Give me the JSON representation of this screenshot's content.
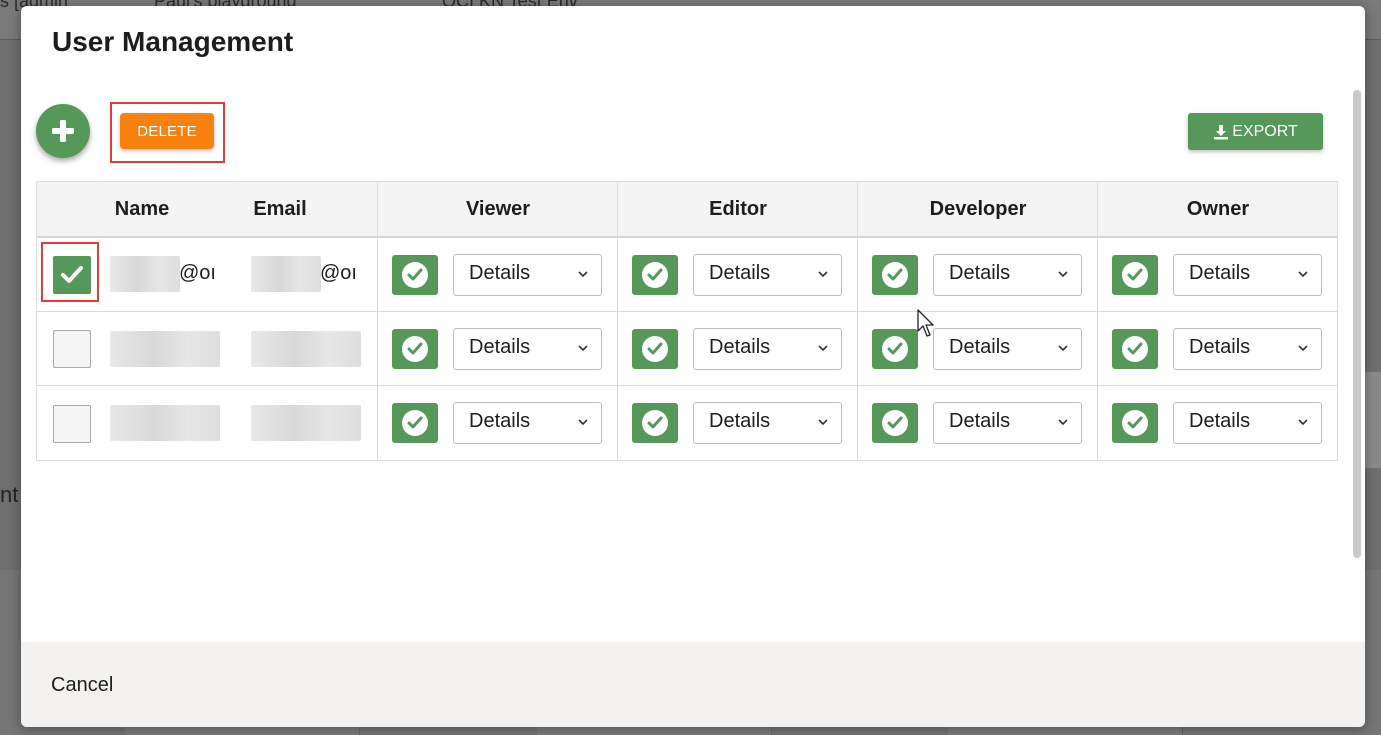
{
  "background": {
    "top_left_fragment": "s [admin",
    "top_title": "Paul's playground",
    "top_env": "OCI KN Test Env",
    "side_fragment": "nt"
  },
  "dialog": {
    "title": "User Management",
    "delete_label": "DELETE",
    "export_label": "EXPORT",
    "cancel_label": "Cancel",
    "accent_green": "#55985a",
    "accent_orange": "#f7820f"
  },
  "table": {
    "columns": [
      "Name",
      "Email",
      "Viewer",
      "Editor",
      "Developer",
      "Owner"
    ],
    "rows": [
      {
        "selected": true,
        "name_suffix": "@oı",
        "email_suffix": "@oı",
        "roles": [
          {
            "checked": true,
            "details": "Details"
          },
          {
            "checked": true,
            "details": "Details"
          },
          {
            "checked": true,
            "details": "Details"
          },
          {
            "checked": true,
            "details": "Details"
          }
        ]
      },
      {
        "selected": false,
        "name_suffix": "",
        "email_suffix": "",
        "roles": [
          {
            "checked": true,
            "details": "Details"
          },
          {
            "checked": true,
            "details": "Details"
          },
          {
            "checked": true,
            "details": "Details"
          },
          {
            "checked": true,
            "details": "Details"
          }
        ]
      },
      {
        "selected": false,
        "name_suffix": "",
        "email_suffix": "",
        "roles": [
          {
            "checked": true,
            "details": "Details"
          },
          {
            "checked": true,
            "details": "Details"
          },
          {
            "checked": true,
            "details": "Details"
          },
          {
            "checked": true,
            "details": "Details"
          }
        ]
      }
    ]
  }
}
